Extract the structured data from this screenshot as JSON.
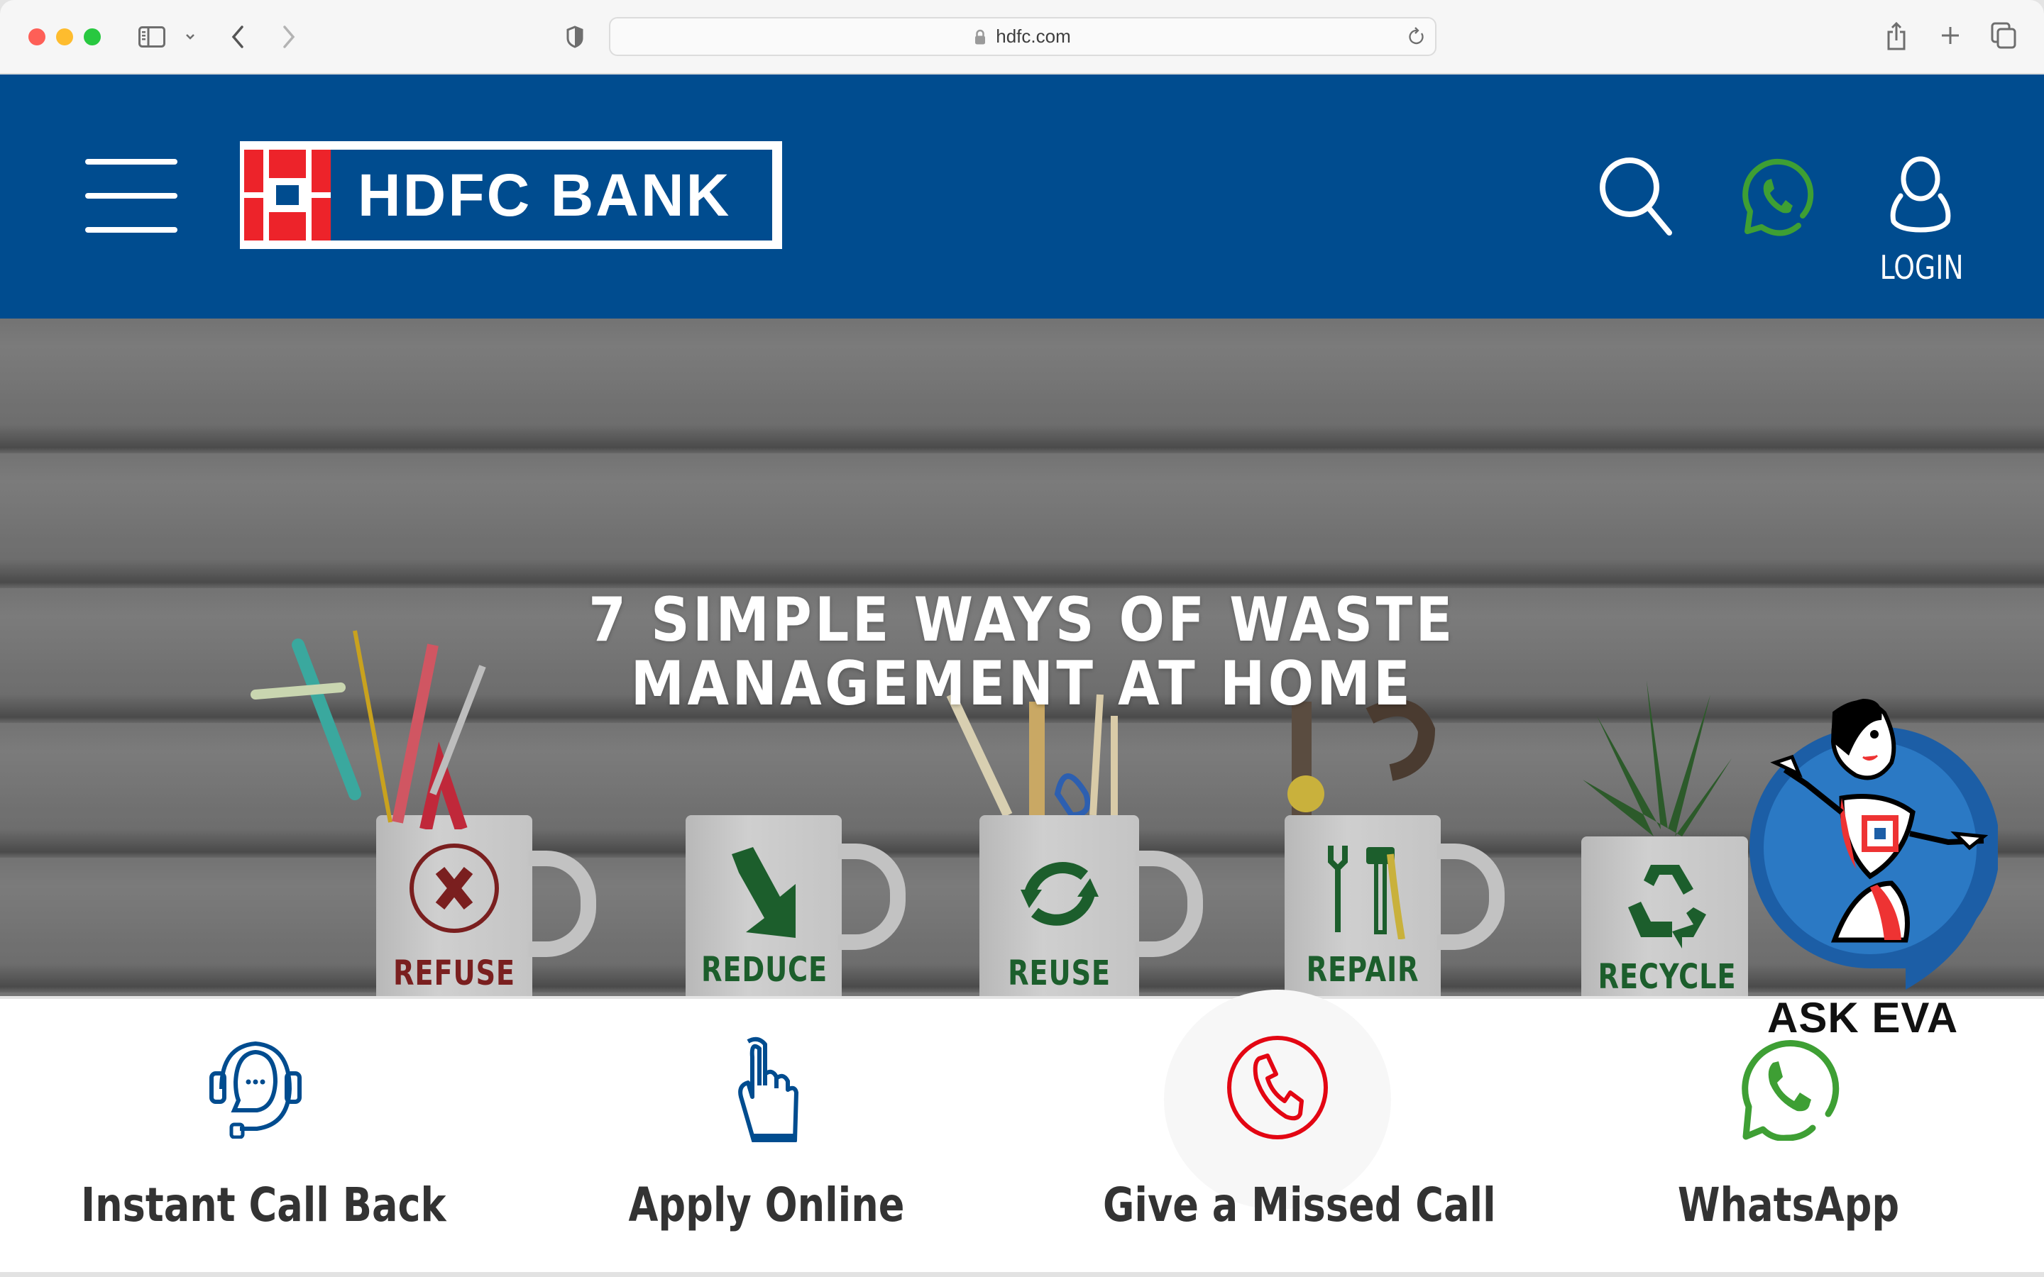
{
  "browser": {
    "url": "hdfc.com",
    "icons": {
      "close": "traffic-light-close",
      "minimize": "traffic-light-minimize",
      "maximize": "traffic-light-maximize",
      "sidebar": "sidebar-icon",
      "sidebar_menu": "chevron-down-icon",
      "back": "chevron-left-icon",
      "forward": "chevron-right-icon",
      "privacy": "shield-icon",
      "lock": "lock-icon",
      "reload": "reload-icon",
      "share": "share-icon",
      "new_tab": "plus-icon",
      "tabs": "tab-overview-icon"
    }
  },
  "header": {
    "brand": "HDFC BANK",
    "login_label": "LOGIN",
    "colors": {
      "primary": "#004c8f",
      "logo_red": "#ed232a",
      "whatsapp_green": "#3e9f34"
    }
  },
  "hero": {
    "title_line1": "7 SIMPLE WAYS OF WASTE",
    "title_line2": "MANAGEMENT AT HOME",
    "mugs": [
      {
        "label": "REFUSE",
        "color": "#7a1f1f"
      },
      {
        "label": "REDUCE",
        "color": "#1c5e2c"
      },
      {
        "label": "REUSE",
        "color": "#1c5e2c"
      },
      {
        "label": "REPAIR",
        "color": "#1c5e2c"
      },
      {
        "label": "RECYCLE",
        "color": "#1c5e2c"
      }
    ]
  },
  "assistant": {
    "label": "ASK EVA"
  },
  "actions": [
    {
      "label": "Instant Call Back",
      "icon": "headset-chat-icon",
      "color": "#004c8f"
    },
    {
      "label": "Apply Online",
      "icon": "hand-pointer-icon",
      "color": "#004c8f"
    },
    {
      "label": "Give a Missed Call",
      "icon": "phone-circle-icon",
      "color": "#e30613"
    },
    {
      "label": "WhatsApp",
      "icon": "whatsapp-icon",
      "color": "#3e9f34"
    }
  ]
}
